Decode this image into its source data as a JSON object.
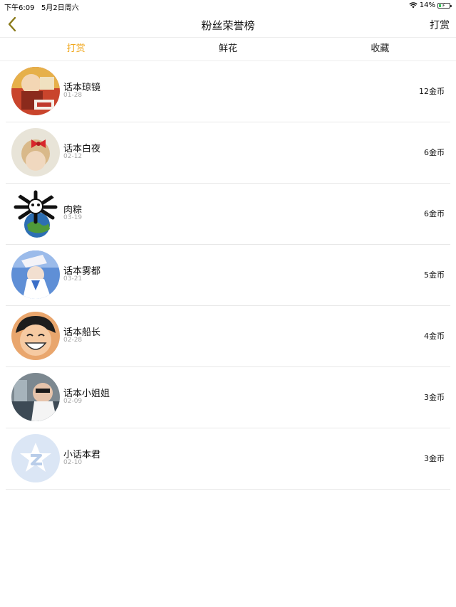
{
  "status_bar": {
    "time": "下午6:09",
    "date": "5月2日周六",
    "battery": "14%"
  },
  "nav": {
    "title": "粉丝荣誉榜",
    "action": "打赏"
  },
  "tabs": [
    {
      "label": "打赏",
      "active": true
    },
    {
      "label": "鲜花",
      "active": false
    },
    {
      "label": "收藏",
      "active": false
    }
  ],
  "accent_color": "#f0a71c",
  "rows": [
    {
      "name": "话本琼镜",
      "date": "01-28",
      "amount": "12金币",
      "avatar": "avatar-cartoon-red"
    },
    {
      "name": "话本白夜",
      "date": "02-12",
      "amount": "6金币",
      "avatar": "avatar-girl-bow"
    },
    {
      "name": "肉粽",
      "date": "03-19",
      "amount": "6金币",
      "avatar": "avatar-crossbones-globe"
    },
    {
      "name": "话本雾都",
      "date": "03-21",
      "amount": "5金币",
      "avatar": "avatar-anime-blue"
    },
    {
      "name": "话本船长",
      "date": "02-28",
      "amount": "4金币",
      "avatar": "avatar-anime-smile"
    },
    {
      "name": "话本小姐姐",
      "date": "02-09",
      "amount": "3金币",
      "avatar": "avatar-photo-man"
    },
    {
      "name": "小话本君",
      "date": "02-10",
      "amount": "3金币",
      "avatar": "avatar-default-star"
    }
  ]
}
